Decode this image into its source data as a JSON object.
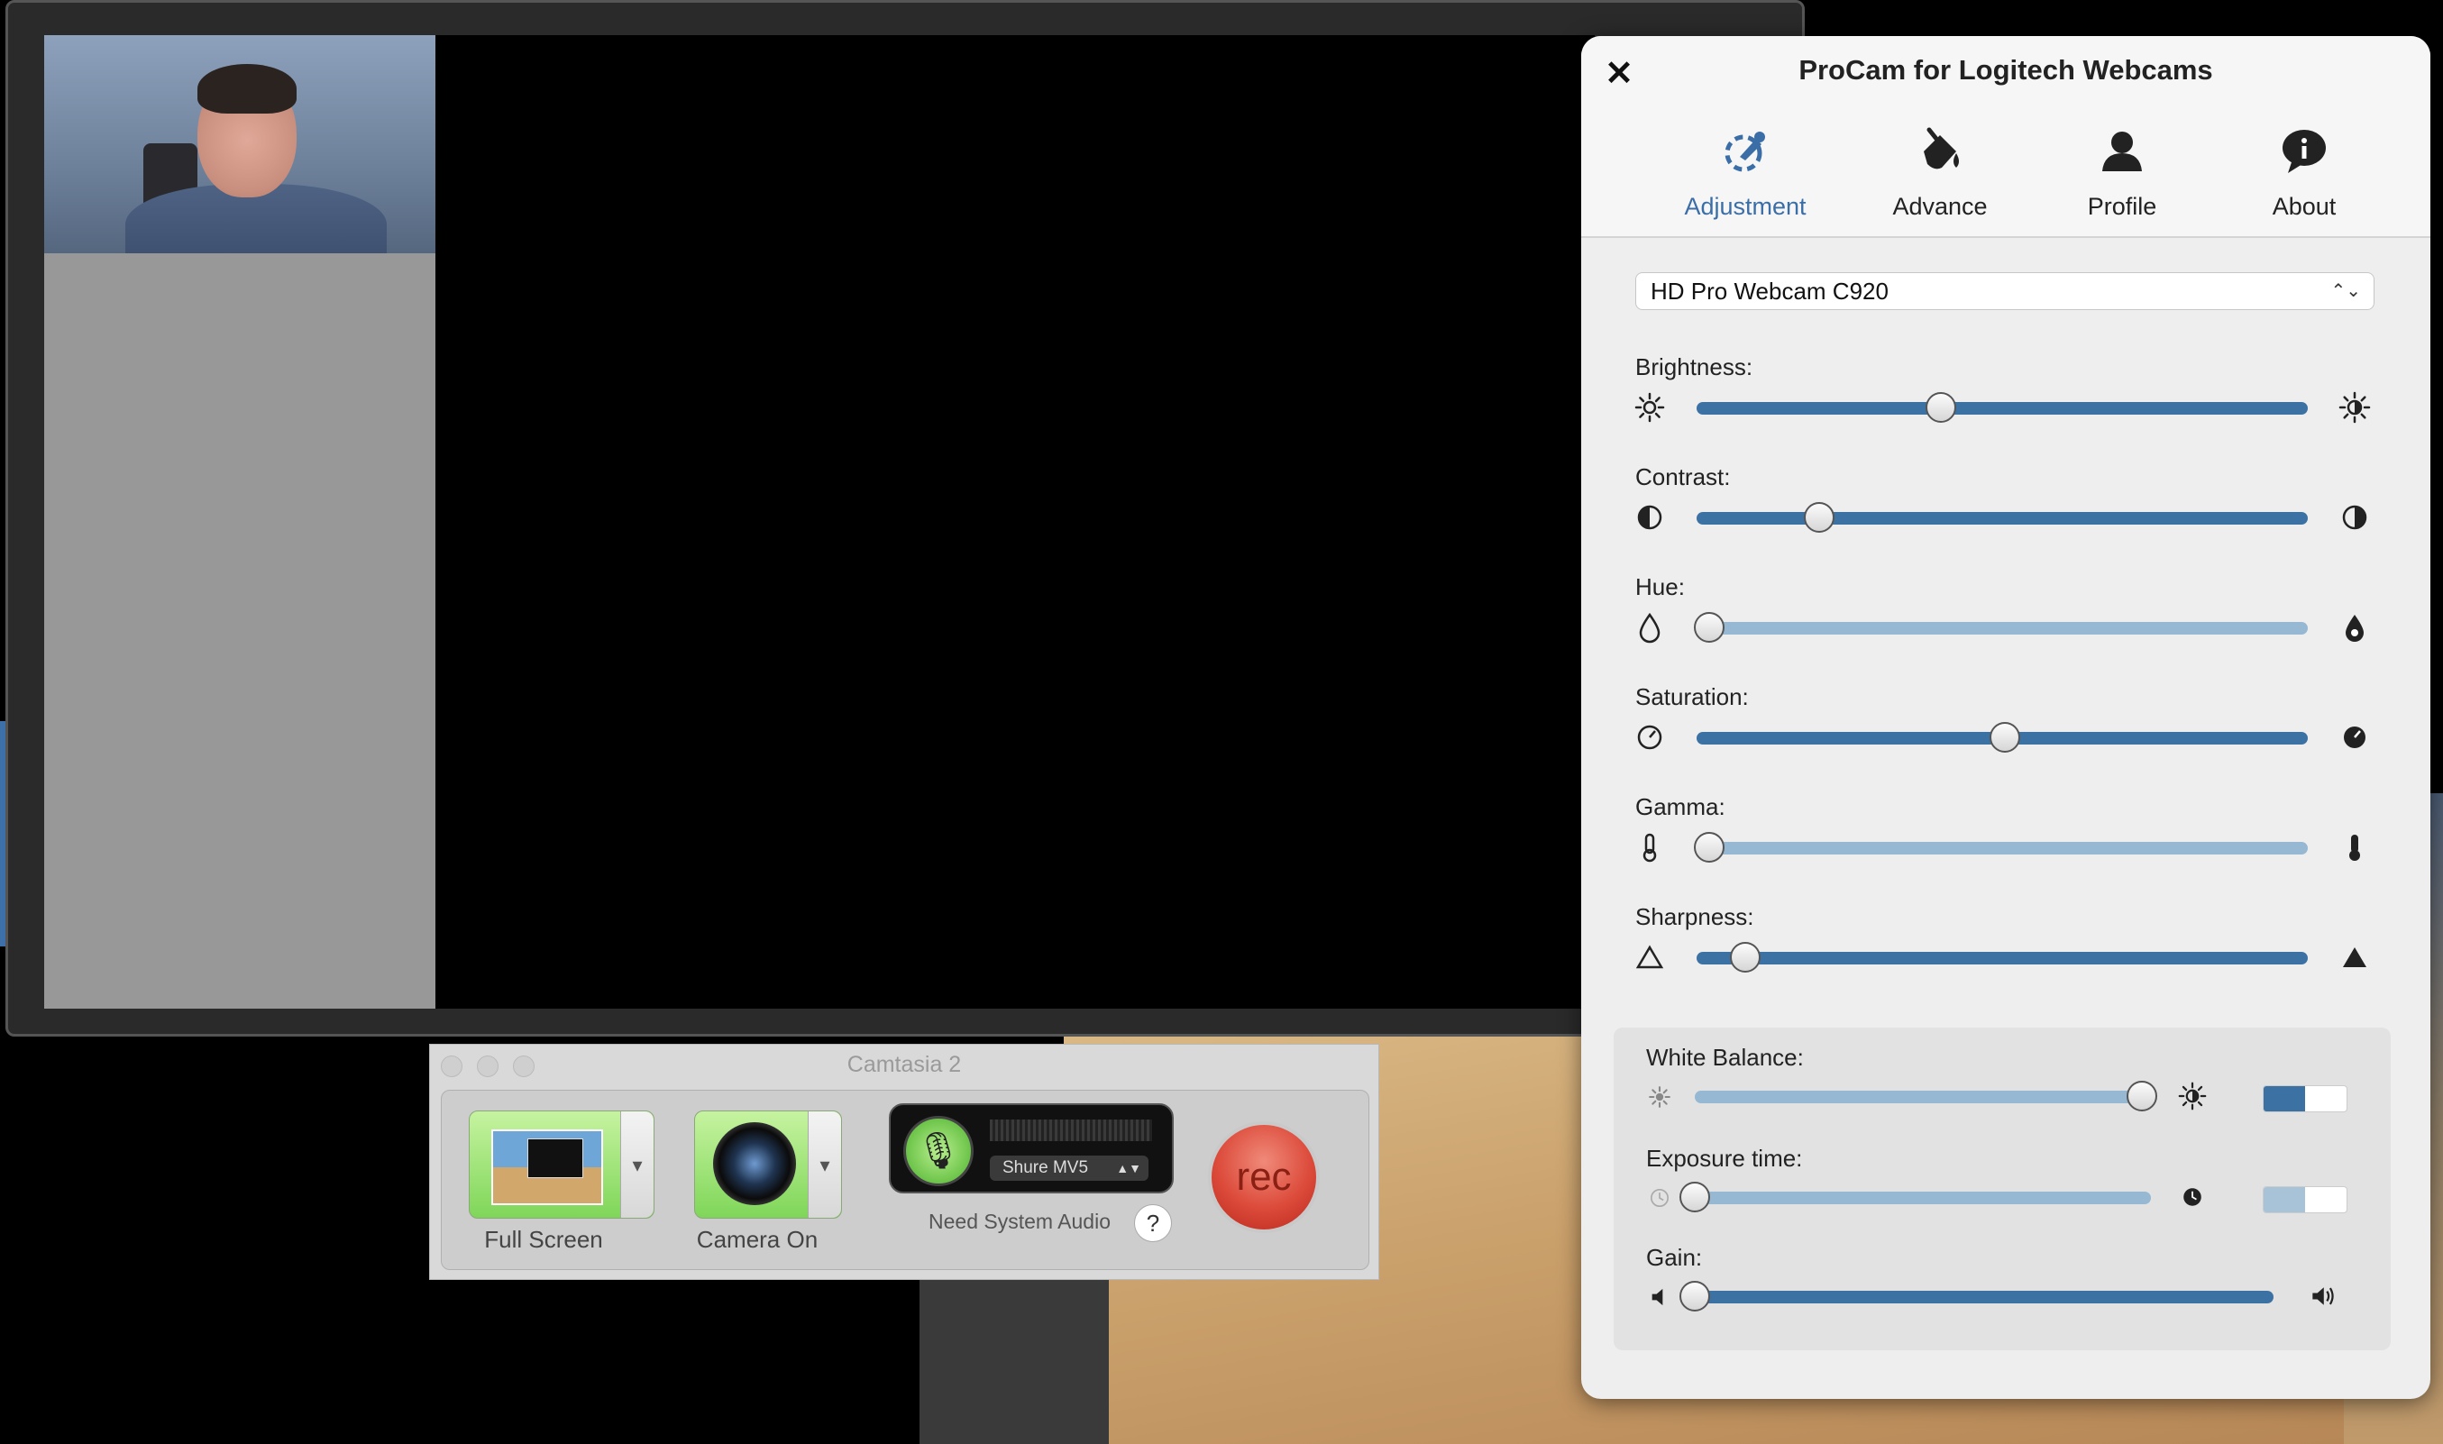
{
  "camtasia": {
    "title": "Camtasia 2",
    "screen_label": "Full Screen",
    "camera_label": "Camera On",
    "audio_device": "Shure MV5",
    "need_audio": "Need System Audio",
    "help": "?",
    "rec_label": "rec"
  },
  "procam": {
    "close": "✕",
    "title": "ProCam for Logitech Webcams",
    "tabs": [
      {
        "label": "Adjustment",
        "icon": "adjustment-icon",
        "active": true
      },
      {
        "label": "Advance",
        "icon": "paint-bucket-icon",
        "active": false
      },
      {
        "label": "Profile",
        "icon": "person-icon",
        "active": false
      },
      {
        "label": "About",
        "icon": "info-icon",
        "active": false
      }
    ],
    "device": "HD Pro Webcam C920",
    "sliders": [
      {
        "label": "Brightness:",
        "value": 0.4,
        "enabled": true,
        "icon_left": "sun-outline-icon",
        "icon_right": "sun-filled-icon"
      },
      {
        "label": "Contrast:",
        "value": 0.2,
        "enabled": true,
        "icon_left": "contrast-icon",
        "icon_right": "contrast-filled-icon"
      },
      {
        "label": "Hue:",
        "value": 0.02,
        "enabled": false,
        "icon_left": "drop-outline-icon",
        "icon_right": "drop-filled-icon"
      },
      {
        "label": "Saturation:",
        "value": 0.505,
        "enabled": true,
        "icon_left": "gauge-outline-icon",
        "icon_right": "gauge-filled-icon"
      },
      {
        "label": "Gamma:",
        "value": 0.02,
        "enabled": false,
        "icon_left": "thermometer-outline-icon",
        "icon_right": "thermometer-filled-icon"
      },
      {
        "label": "Sharpness:",
        "value": 0.08,
        "enabled": true,
        "icon_left": "triangle-outline-icon",
        "icon_right": "triangle-filled-icon"
      }
    ],
    "auto_sliders": [
      {
        "label": "White Balance:",
        "value": 0.98,
        "enabled": false,
        "auto": true,
        "icon_left": "sun-small-icon",
        "icon_right": "sun-filled-icon"
      },
      {
        "label": "Exposure time:",
        "value": 0.0,
        "enabled": false,
        "auto": false,
        "icon_left": "clock-outline-icon",
        "icon_right": "clock-filled-icon"
      },
      {
        "label": "Gain:",
        "value": 0.0,
        "enabled": true,
        "icon_left": "speaker-low-icon",
        "icon_right": "speaker-high-icon"
      }
    ]
  }
}
